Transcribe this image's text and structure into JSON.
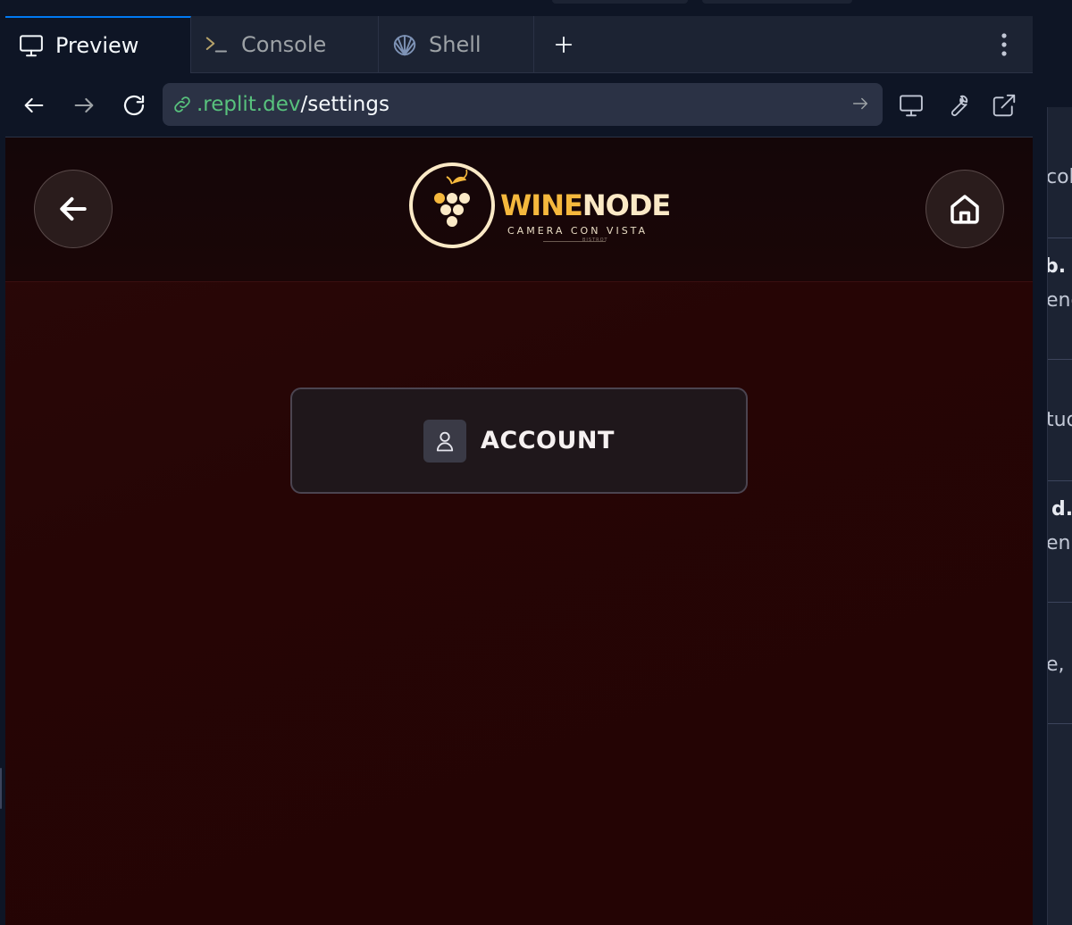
{
  "tabs": [
    {
      "label": "Preview",
      "icon": "monitor-icon",
      "active": true
    },
    {
      "label": "Console",
      "icon": "terminal-icon",
      "active": false
    },
    {
      "label": "Shell",
      "icon": "shell-icon",
      "active": false
    }
  ],
  "url": {
    "host": ".replit.dev",
    "path": "/settings"
  },
  "app": {
    "logo_word_1": "WINE",
    "logo_word_2": "NODE",
    "logo_subtitle": "CAMERA CON VISTA",
    "logo_tagline": "BISTROT",
    "account_label": "ACCOUNT"
  },
  "right_panel": {
    "rows": [
      "colo",
      "b.",
      "enc",
      "tud",
      "d.",
      "enu",
      "e,"
    ]
  },
  "colors": {
    "ide_bg": "#0e1525",
    "ide_surface": "#1c2333",
    "accent_blue": "#0079f2",
    "url_green": "#58c27d",
    "wine_gold": "#f5b83d",
    "wine_cream": "#fbe9c6",
    "wine_bg": "#250505"
  }
}
